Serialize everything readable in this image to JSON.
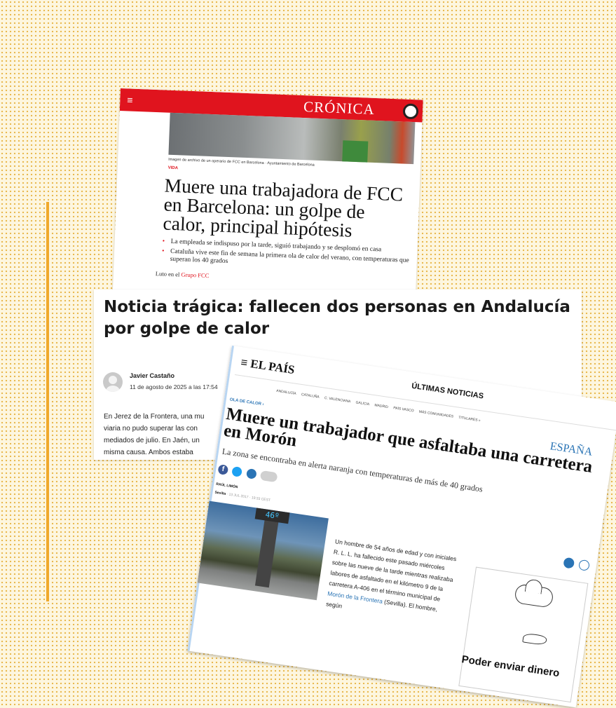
{
  "cronica": {
    "logo": "CRÓNICA",
    "menu_icon": "≡",
    "caption": "Imagen de archivo de un operario de FCC en Barcelona · Ayuntamiento de Barcelona",
    "section": "VIDA",
    "headline": "Muere una trabajadora de FCC en Barcelona: un golpe de calor, principal hipótesis",
    "bullets": [
      "La empleada se indispuso por la tarde, siguió trabajando y se desplomó en casa",
      "Cataluña vive este fin de semana la primera ola de calor del verano, con temperaturas que superan los 40 grados"
    ],
    "author_row_prefix": "Luto en el",
    "author_row_link": "Grupo FCC"
  },
  "article2": {
    "headline": "Noticia trágica: fallecen dos personas en Andalucía por golpe de calor",
    "author": "Javier Castaño",
    "date": "11 de agosto de 2025 a las 17:54",
    "body_lines": [
      "En Jerez de la Frontera, una mu",
      "viaria no pudo superar las con",
      "mediados de julio. En Jaén, un",
      "misma causa. Ambos estaba"
    ]
  },
  "elpais": {
    "logo": "≡ EL PAÍS",
    "latest": "ÚLTIMAS NOTICIAS",
    "regions": [
      "ANDALUCÍA",
      "CATALUÑA",
      "C. VALENCIANA",
      "GALICIA",
      "MADRID",
      "PAÍS VASCO",
      "MÁS COMUNIDADES",
      "TITULARES »"
    ],
    "kicker": "OLA DE CALOR ›",
    "section": "ESPAÑA",
    "headline": "Muere un trabajador que asfaltaba una carretera en Morón",
    "subheadline": "La zona se encontraba en alerta naranja con temperaturas de más de 40 grados",
    "author": "RAÚL LIMÓN",
    "place": "Sevilla",
    "place_date": " · 13 JUL 2017 · 19:33 CEST",
    "thermometer": "46º",
    "article_text": "Un hombre de 54 años de edad y con iniciales R. L. L. ha fallecido este pasado miércoles sobre las nueve de la tarde mientras realizaba labores de asfaltado en el kilómetro 9 de la carretera A-406 en el término municipal de ",
    "article_link": "Morón de la Frontera",
    "article_tail": " (Sevilla). El hombre, según",
    "ad_text": "Poder enviar dinero"
  },
  "colors": {
    "background": "#fdf6df",
    "dots": "#e9b94f",
    "accent_bar": "#f0a92c",
    "cronica_red": "#e0141e",
    "elpais_blue": "#2a74b5"
  }
}
